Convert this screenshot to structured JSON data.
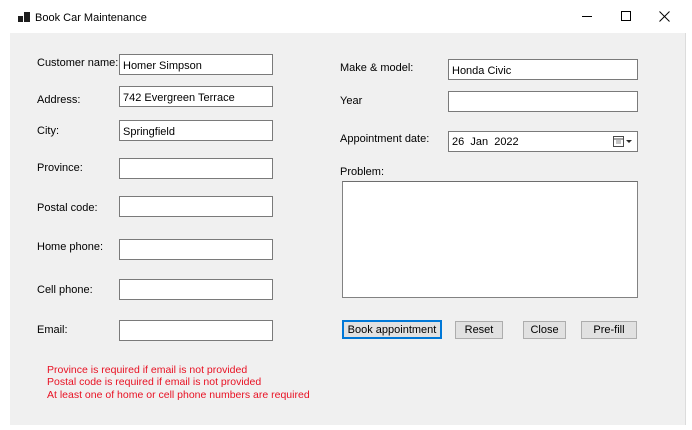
{
  "window": {
    "title": "Book Car Maintenance",
    "icon": "app-icon",
    "controls": {
      "minimize": "minimize-icon",
      "maximize": "maximize-icon",
      "close": "close-icon"
    }
  },
  "form": {
    "customer_name": {
      "label": "Customer name:",
      "value": "Homer Simpson"
    },
    "address": {
      "label": "Address:",
      "value": "742 Evergreen Terrace"
    },
    "city": {
      "label": "City:",
      "value": "Springfield"
    },
    "province": {
      "label": "Province:",
      "value": ""
    },
    "postal_code": {
      "label": "Postal code:",
      "value": ""
    },
    "home_phone": {
      "label": "Home phone:",
      "value": ""
    },
    "cell_phone": {
      "label": "Cell phone:",
      "value": ""
    },
    "email": {
      "label": "Email:",
      "value": ""
    },
    "make_model": {
      "label": "Make & model:",
      "value": "Honda Civic"
    },
    "year": {
      "label": "Year",
      "value": ""
    },
    "appointment_date": {
      "label": "Appointment date:",
      "value": "26  Jan  2022",
      "icon": "calendar-dropdown-icon"
    },
    "problem": {
      "label": "Problem:",
      "value": ""
    }
  },
  "buttons": {
    "book": "Book appointment",
    "reset": "Reset",
    "close": "Close",
    "prefill": "Pre-fill"
  },
  "errors": [
    "Province is required if email is not provided",
    "Postal code is required if email is not provided",
    "At least one of home or cell phone numbers are required"
  ],
  "colors": {
    "error": "#e81123",
    "default_button_border": "#0078d7",
    "client_background": "#f0f0f0"
  }
}
